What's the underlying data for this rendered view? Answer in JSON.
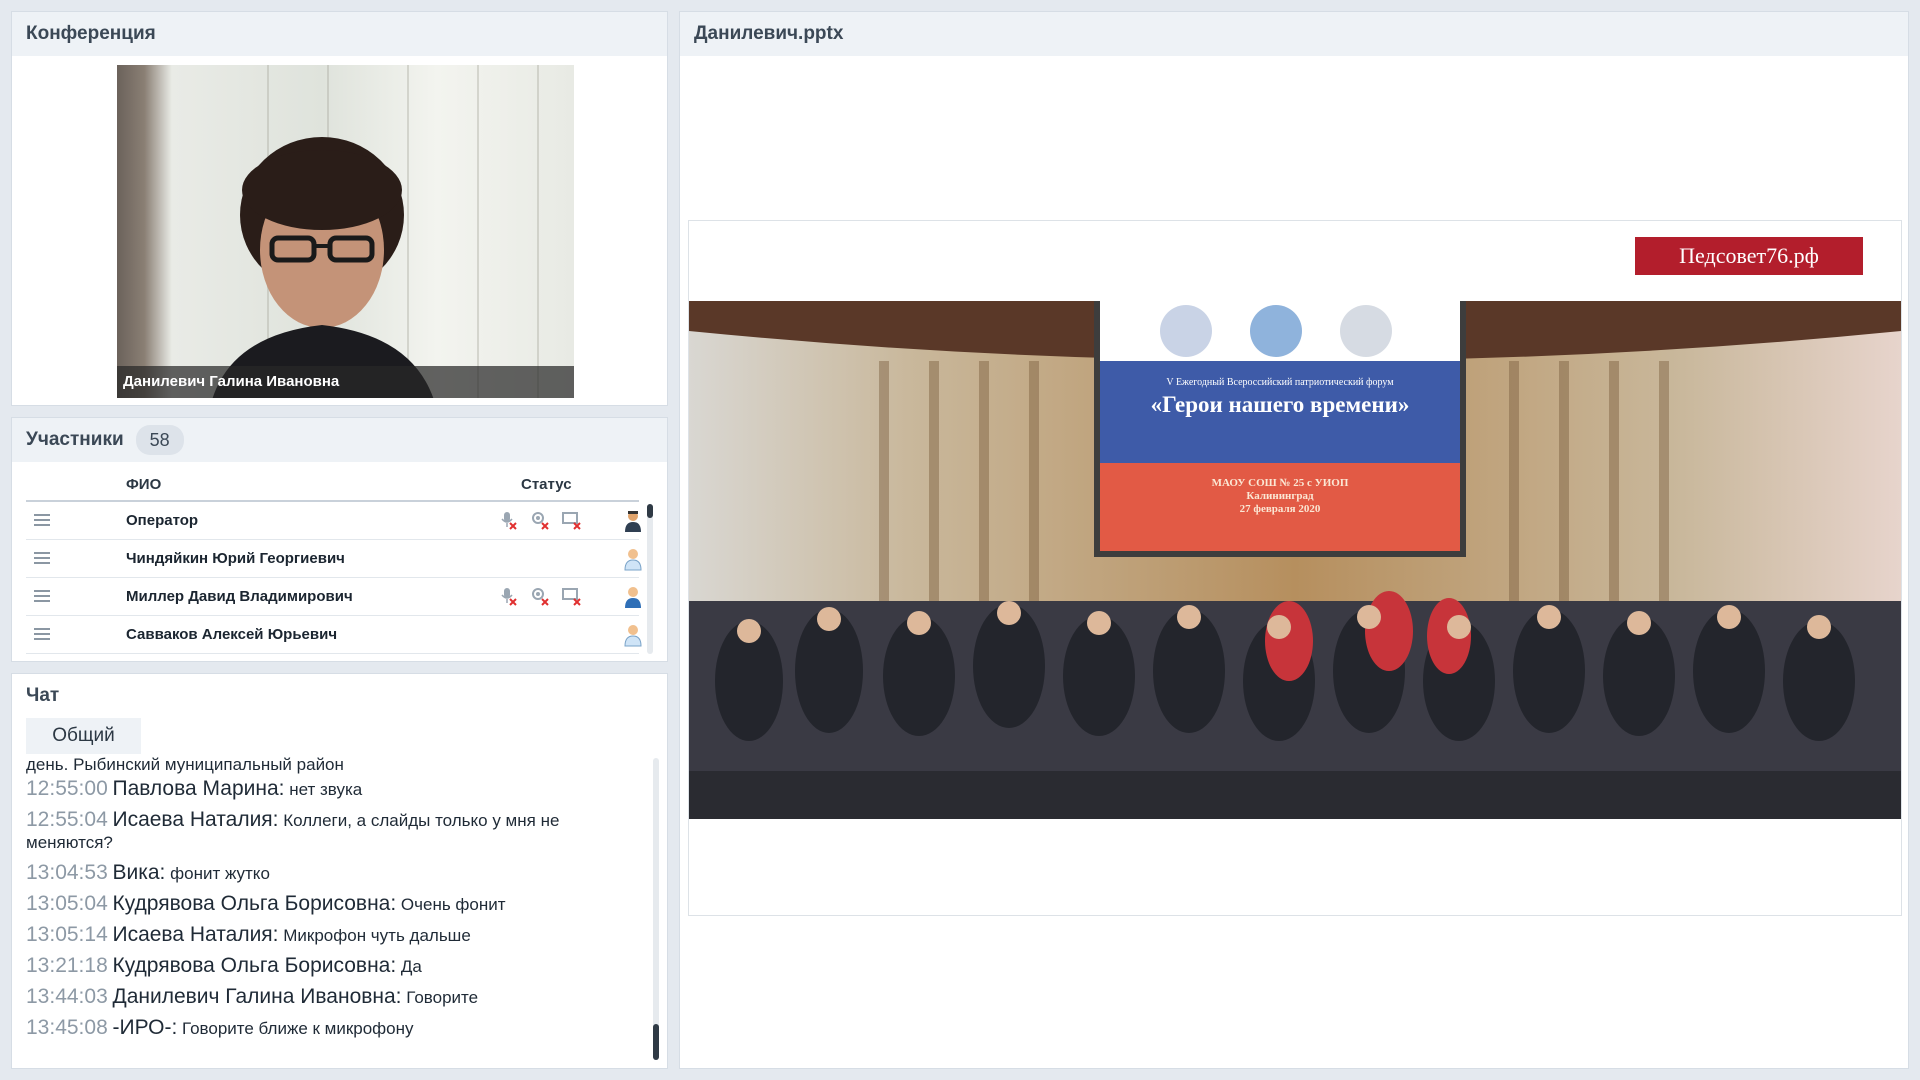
{
  "conference": {
    "title": "Конференция",
    "video_caption": "Данилевич Галина Ивановна"
  },
  "participants": {
    "title": "Участники",
    "count": "58",
    "columns": {
      "name": "ФИО",
      "status": "Статус"
    },
    "rows": [
      {
        "name": "Оператор",
        "mic_muted": true,
        "cam_muted": true,
        "screen_muted": true,
        "role": "operator"
      },
      {
        "name": "Чиндяйкин Юрий  Георгиевич",
        "mic_muted": false,
        "cam_muted": false,
        "screen_muted": false,
        "role": "participant"
      },
      {
        "name": "Миллер Давид  Владимирович",
        "mic_muted": true,
        "cam_muted": true,
        "screen_muted": true,
        "role": "presenter"
      },
      {
        "name": "Савваков Алексей Юрьевич",
        "mic_muted": false,
        "cam_muted": false,
        "screen_muted": false,
        "role": "participant"
      }
    ]
  },
  "chat": {
    "title": "Чат",
    "tab": "Общий",
    "partial_line": "день. Рыбинский муниципальный район",
    "messages": [
      {
        "time": "12:55:00",
        "author": "Павлова Марина:",
        "text": "нет звука"
      },
      {
        "time": "12:55:04",
        "author": "Исаева Наталия:",
        "text": "Коллеги, а слайды только у мня не меняются?"
      },
      {
        "time": "13:04:53",
        "author": "Вика:",
        "text": "фонит жутко"
      },
      {
        "time": "13:05:04",
        "author": "Кудрявова Ольга  Борисовна:",
        "text": "Очень фонит"
      },
      {
        "time": "13:05:14",
        "author": "Исаева Наталия:",
        "text": "Микрофон чуть дальше"
      },
      {
        "time": "13:21:18",
        "author": "Кудрявова Ольга  Борисовна:",
        "text": "Да"
      },
      {
        "time": "13:44:03",
        "author": "Данилевич Галина Ивановна:",
        "text": "Говорите"
      },
      {
        "time": "13:45:08",
        "author": "-ИРО-:",
        "text": "Говорите ближе к микрофону"
      }
    ]
  },
  "presentation": {
    "title": "Данилевич.pptx",
    "logo": "Педсовет76.рф",
    "screen_subtitle": "V Ежегодный Всероссийский патриотический форум",
    "screen_title": "«Герои нашего времени»",
    "screen_lines": [
      "МАОУ СОШ № 25 с УИОП",
      "Калининград",
      "27 февраля 2020"
    ],
    "colors": {
      "logo_bg": "#b31e2c",
      "screen_blue": "#3e5ba8",
      "screen_red": "#e25a45"
    }
  }
}
